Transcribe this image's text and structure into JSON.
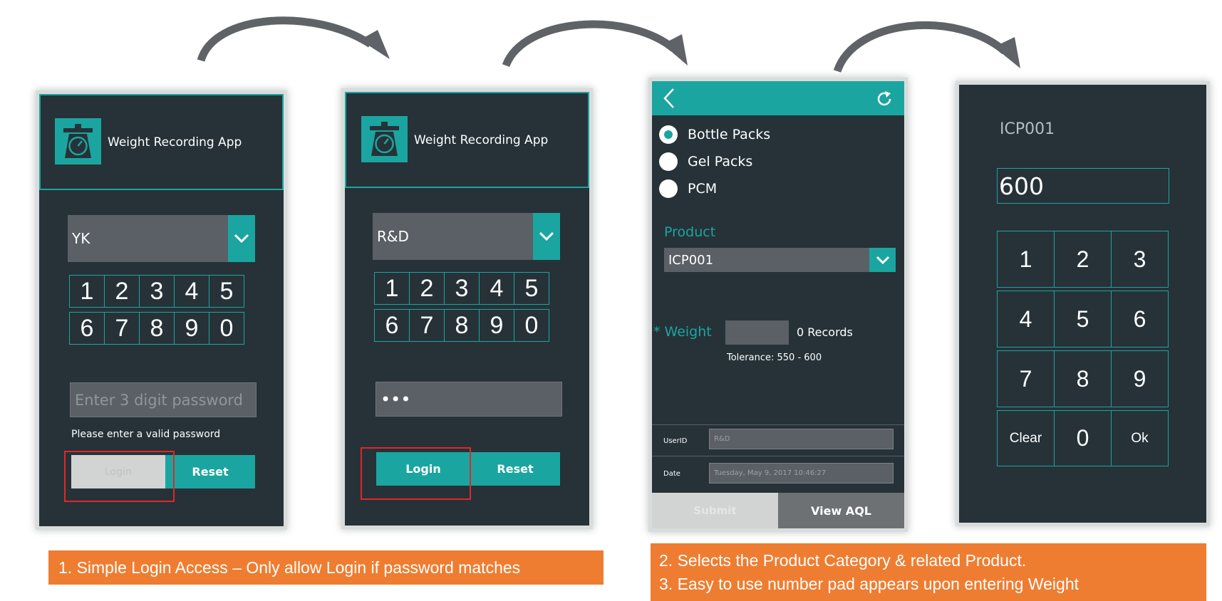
{
  "app": {
    "title": "Weight Recording App"
  },
  "login1": {
    "user": "YK",
    "keys_row1": [
      "1",
      "2",
      "3",
      "4",
      "5"
    ],
    "keys_row2": [
      "6",
      "7",
      "8",
      "9",
      "0"
    ],
    "password_placeholder": "Enter 3 digit password",
    "error": "Please enter a valid password",
    "login_label": "Login",
    "reset_label": "Reset"
  },
  "login2": {
    "user": "R&D",
    "keys_row1": [
      "1",
      "2",
      "3",
      "4",
      "5"
    ],
    "keys_row2": [
      "6",
      "7",
      "8",
      "9",
      "0"
    ],
    "password_value": "•••",
    "login_label": "Login",
    "reset_label": "Reset"
  },
  "product_screen": {
    "back_icon": "chevron-left-icon",
    "refresh_icon": "refresh-icon",
    "categories": [
      {
        "label": "Bottle Packs",
        "selected": true
      },
      {
        "label": "Gel Packs",
        "selected": false
      },
      {
        "label": "PCM",
        "selected": false
      }
    ],
    "product_label": "Product",
    "product_value": "ICP001",
    "weight_label": "* Weight",
    "records": "0 Records",
    "tolerance": "Tolerance: 550 - 600",
    "userid_label": "UserID",
    "userid_value": "R&D",
    "date_label": "Date",
    "date_value": "Tuesday, May 9, 2017 10:46:27",
    "submit_label": "Submit",
    "view_aql_label": "View AQL"
  },
  "numpad_screen": {
    "product": "ICP001",
    "value": "600",
    "keys": [
      "1",
      "2",
      "3",
      "4",
      "5",
      "6",
      "7",
      "8",
      "9",
      "Clear",
      "0",
      "Ok"
    ]
  },
  "banners": {
    "left": "1. Simple Login Access – Only allow Login if password matches",
    "right_line1": "2. Selects the Product Category & related Product.",
    "right_line2": "3. Easy to use number pad appears upon entering Weight"
  },
  "colors": {
    "accent": "#1ba5a0",
    "panel": "#263238",
    "banner": "#ee7d31",
    "highlight": "#e32626"
  }
}
